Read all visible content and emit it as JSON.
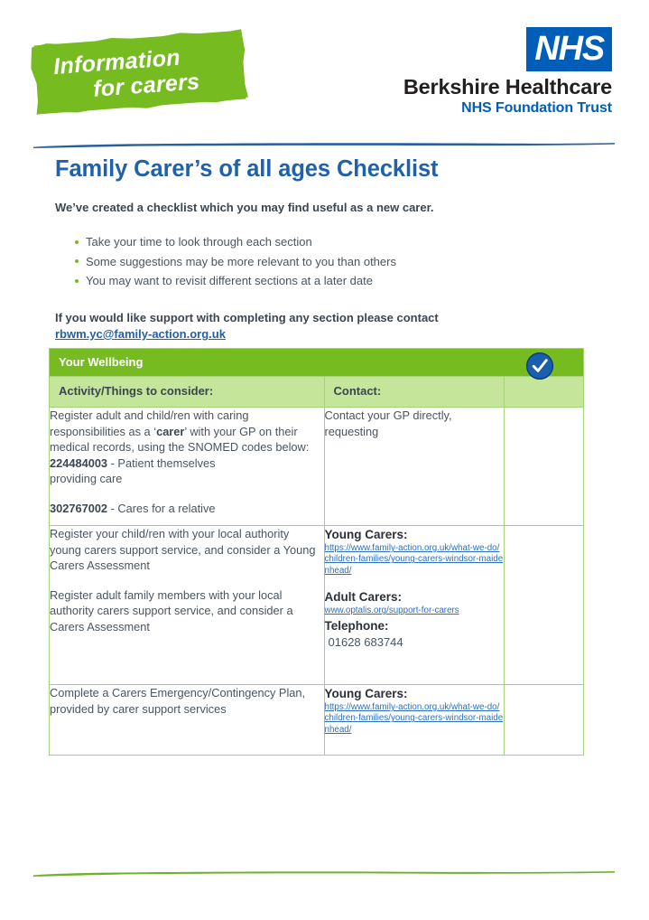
{
  "header": {
    "brandmark": {
      "line1": "Information",
      "line2": "for carers",
      "color": "#76bc21"
    },
    "nhs": {
      "logo_text": "NHS",
      "trust_name": "Berkshire Healthcare",
      "trust_sub": "NHS Foundation Trust",
      "nhs_blue": "#005eb8"
    }
  },
  "title": "Family Carer’s of all ages Checklist",
  "intro": {
    "lead": "We’ve created a checklist which you may find useful as a new carer.",
    "bullets": [
      "Take your time to look through each section",
      "Some suggestions may be more relevant to you than others",
      "You may want to revisit different sections at a later date"
    ],
    "contact_line": "If you would like support with completing any section please contact",
    "contact_email": "rbwm.yc@family-action.org.uk"
  },
  "table": {
    "section_title": "Your Wellbeing",
    "tick_icon": "check-circle-icon",
    "columns": [
      "Activity/Things to consider:",
      "Contact:",
      ""
    ],
    "rows": [
      {
        "activity": {
          "line1": "Register adult and child/ren with caring",
          "line2_pre": "responsibilities as a ‘",
          "line2_bold": "carer",
          "line2_post": "’ with your GP on",
          "line3": "their medical records, using the SNOMED",
          "line4": "codes below:",
          "code1": "224484003",
          "code1_desc": " - Patient themselves",
          "code1_desc2": "providing care",
          "code2": "302767002",
          "code2_desc": " - Cares for a relative"
        },
        "contact": {
          "text": "Contact your GP directly, requesting"
        }
      },
      {
        "activity": {
          "para1": "Register your child/ren with your local authority young carers support service, and consider a Young Carers Assessment",
          "para2": "Register adult family members with your local authority carers support service, and consider a Carers Assessment"
        },
        "contact": {
          "young_carers_label": "Young Carers:",
          "young_carers_url": "https://www.family-action.org.uk/what-we-do/children-families/young-carers-windsor-maidenhead/",
          "adult_carers_label": "Adult Carers:",
          "adult_carers_url": "www.optalis.org/support-for-carers",
          "telephone_label": "Telephone:",
          "telephone_number": "01628 683744"
        }
      },
      {
        "activity": {
          "para1": "Complete a Carers Emergency/Contingency Plan, provided by carer support services"
        },
        "contact": {
          "young_carers_label": "Young Carers:",
          "young_carers_url": "https://www.family-action.org.uk/what-we-do/children-families/young-carers-windsor-maidenhead/"
        }
      }
    ]
  },
  "decor": {
    "rule_blue_color": "#2a5f9e",
    "rule_green_color": "#6fb22a"
  }
}
